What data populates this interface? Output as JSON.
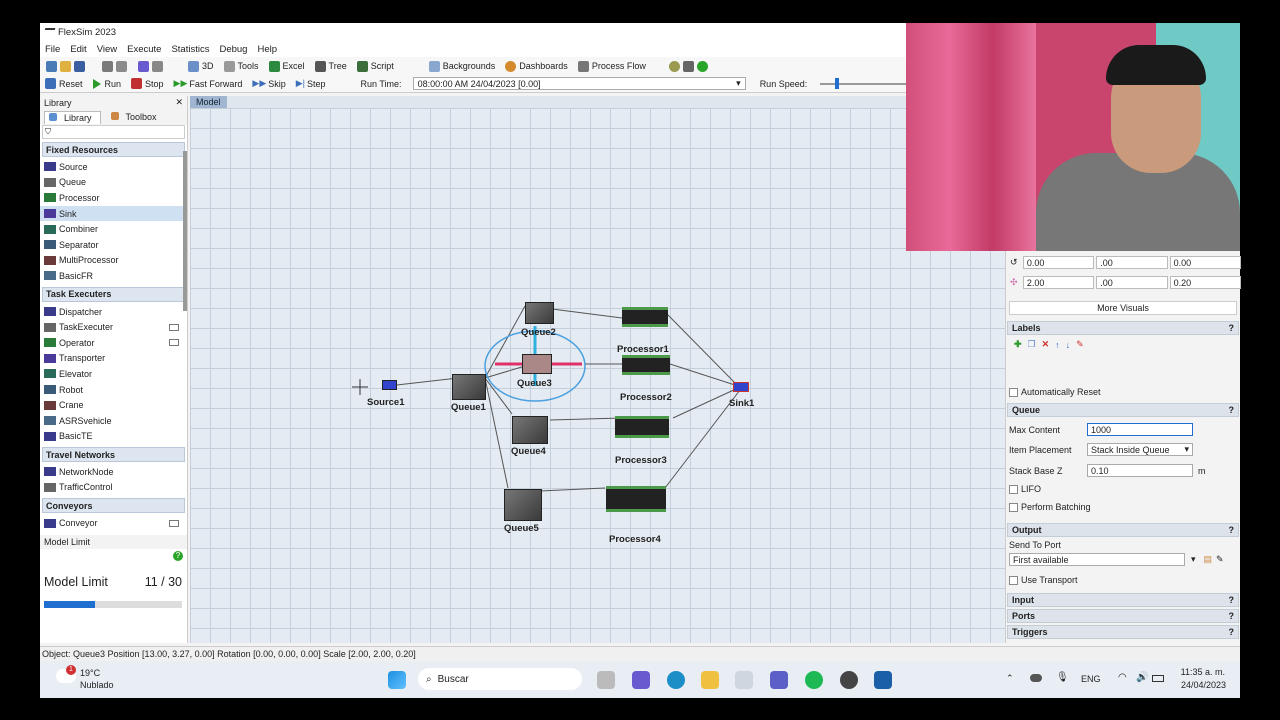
{
  "window": {
    "title": "FlexSim 2023"
  },
  "menu": [
    "File",
    "Edit",
    "View",
    "Execute",
    "Statistics",
    "Debug",
    "Help"
  ],
  "toolbar1": {
    "three_d": "3D",
    "tools": "Tools",
    "excel": "Excel",
    "tree": "Tree",
    "script": "Script",
    "backgrounds": "Backgrounds",
    "dashboards": "Dashboards",
    "process_flow": "Process Flow"
  },
  "toolbar2": {
    "reset": "Reset",
    "run": "Run",
    "stop": "Stop",
    "fast_forward": "Fast Forward",
    "skip": "Skip",
    "step": "Step",
    "run_time_label": "Run Time:",
    "run_time_value": "08:00:00 AM  24/04/2023  [0.00]",
    "run_speed_label": "Run Speed:"
  },
  "library": {
    "title": "Library",
    "tab_library": "Library",
    "tab_toolbox": "Toolbox",
    "categories": [
      {
        "name": "Fixed Resources",
        "items": [
          "Source",
          "Queue",
          "Processor",
          "Sink",
          "Combiner",
          "Separator",
          "MultiProcessor",
          "BasicFR"
        ]
      },
      {
        "name": "Task Executers",
        "items": [
          "Dispatcher",
          "TaskExecuter",
          "Operator",
          "Transporter",
          "Elevator",
          "Robot",
          "Crane",
          "ASRSvehicle",
          "BasicTE"
        ]
      },
      {
        "name": "Travel Networks",
        "items": [
          "NetworkNode",
          "TrafficControl"
        ]
      },
      {
        "name": "Conveyors",
        "items": [
          "Conveyor"
        ]
      }
    ]
  },
  "model_limit": {
    "title": "Model Limit",
    "label": "Model Limit",
    "value": "11 / 30",
    "fraction": 0.367
  },
  "view": {
    "tab": "Model"
  },
  "model_objects": {
    "source1": "Source1",
    "queue1": "Queue1",
    "queue2": "Queue2",
    "queue3": "Queue3",
    "queue4": "Queue4",
    "queue5": "Queue5",
    "processor1": "Processor1",
    "processor2": "Processor2",
    "processor3": "Processor3",
    "processor4": "Processor4",
    "sink1": "Sink1"
  },
  "properties": {
    "rot": [
      "0.00",
      ".00",
      "0.00"
    ],
    "scale": [
      "2.00",
      ".00",
      "0.20"
    ],
    "more_visuals": "More Visuals",
    "labels_section": "Labels",
    "auto_reset": "Automatically Reset",
    "queue_section": "Queue",
    "max_content_label": "Max Content",
    "max_content_value": "1000",
    "item_placement_label": "Item Placement",
    "item_placement_value": "Stack Inside Queue",
    "stack_base_label": "Stack Base Z",
    "stack_base_value": "0.10",
    "stack_base_unit": "m",
    "lifo": "LIFO",
    "perform_batching": "Perform Batching",
    "output_section": "Output",
    "send_to_port_label": "Send To Port",
    "send_to_port_value": "First available",
    "use_transport": "Use Transport",
    "input_section": "Input",
    "ports_section": "Ports",
    "triggers_section": "Triggers"
  },
  "status_bar": "Object: Queue3 Position [13.00, 3.27, 0.00]  Rotation [0.00, 0.00, 0.00]  Scale [2.00, 2.00, 0.20]",
  "taskbar": {
    "weather_temp": "19°C",
    "weather_desc": "Nublado",
    "weather_badge": "1",
    "search": "Buscar",
    "lang": "ENG",
    "time": "11:35 a. m.",
    "date": "24/04/2023"
  }
}
